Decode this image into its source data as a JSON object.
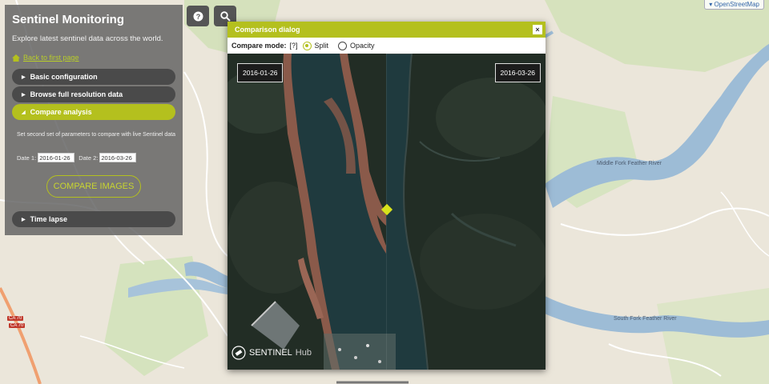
{
  "app": {
    "title": "Sentinel Monitoring",
    "subtitle": "Explore latest sentinel data across the world.",
    "back_link": "Back to first page"
  },
  "accordion": [
    {
      "label": "Basic configuration",
      "active": false
    },
    {
      "label": "Browse full resolution data",
      "active": false
    },
    {
      "label": "Compare analysis",
      "active": true
    },
    {
      "label": "Time lapse",
      "active": false
    }
  ],
  "compare": {
    "description": "Set second set of parameters to compare with live Sentinel data",
    "date1_label": "Date 1:",
    "date1_value": "2016-01-26",
    "date2_label": "Date 2:",
    "date2_value": "2016-03-26",
    "button": "COMPARE IMAGES"
  },
  "toolbar": {
    "help_glyph": "?",
    "search_icon": "search-icon"
  },
  "dialog": {
    "title": "Comparison dialog",
    "close": "×",
    "mode_label": "Compare mode:",
    "mode_help": "[?]",
    "modes": [
      "Split",
      "Opacity"
    ],
    "selected_mode": "Split",
    "left_date": "2016-01-26",
    "right_date": "2016-03-26",
    "logo_text": "SENTINEL",
    "logo_suffix": "Hub"
  },
  "map": {
    "attribution": "OpenStreetMap",
    "labels": [
      "Middle Fork Feather River",
      "South Fork Feather River"
    ],
    "shield": "CA 70"
  },
  "colors": {
    "accent": "#b4c01e",
    "panel": "#5f5f5f",
    "water": "#9dbcd6"
  }
}
